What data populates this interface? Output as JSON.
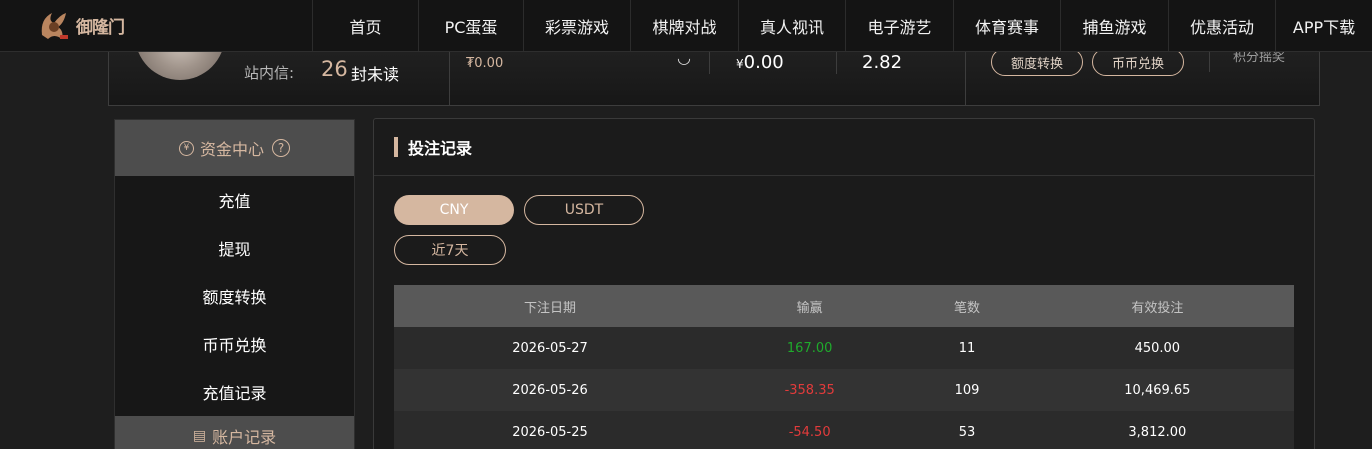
{
  "logo": {
    "text": "御隆门"
  },
  "nav": [
    "首页",
    "PC蛋蛋",
    "彩票游戏",
    "棋牌对战",
    "真人视讯",
    "电子游艺",
    "体育赛事",
    "捕鱼游戏",
    "优惠活动",
    "APP下载"
  ],
  "user_panel": {
    "message_label": "站内信:",
    "message_count": "26",
    "message_unread": "封未读",
    "balance_main": "₮0.00",
    "balance_yen_symbol": "¥",
    "balance_yen": "0.00",
    "points": "2.82",
    "transfer_button": "额度转换",
    "exchange_button": "币币兑换",
    "right_text": "积分摇奖"
  },
  "sidebar": {
    "section1": {
      "title": "资金中心",
      "icon": "yen-circle-icon",
      "help": "?"
    },
    "items": [
      "充值",
      "提现",
      "额度转换",
      "币币兑换",
      "充值记录"
    ],
    "section2": {
      "title": "账户记录",
      "icon": "record-icon"
    }
  },
  "main": {
    "title": "投注记录",
    "currency_buttons": [
      "CNY",
      "USDT"
    ],
    "active_currency": "CNY",
    "period_button": "近7天",
    "table": {
      "headers": [
        "下注日期",
        "输赢",
        "笔数",
        "有效投注"
      ],
      "rows": [
        {
          "date": "2026-05-27",
          "profit": "167.00",
          "count": "11",
          "valid": "450.00",
          "sign": "pos"
        },
        {
          "date": "2026-05-26",
          "profit": "-358.35",
          "count": "109",
          "valid": "10,469.65",
          "sign": "neg"
        },
        {
          "date": "2026-05-25",
          "profit": "-54.50",
          "count": "53",
          "valid": "3,812.00",
          "sign": "neg"
        }
      ]
    }
  },
  "colors": {
    "accent": "#d5b7a0",
    "positive": "#1faa2c",
    "negative": "#e23b3b",
    "header_bg": "#595959"
  }
}
